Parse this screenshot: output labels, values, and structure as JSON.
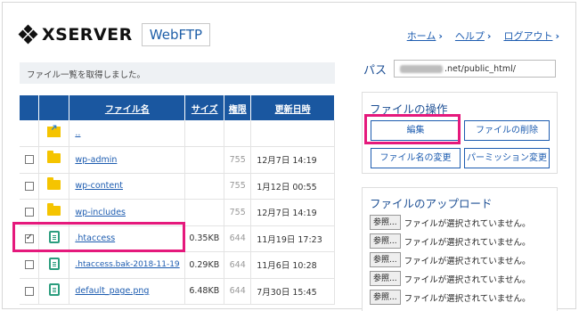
{
  "header": {
    "brand": "XSERVER",
    "app_badge": "WebFTP",
    "links": [
      {
        "label": "ホーム",
        "chevron": "›"
      },
      {
        "label": "ヘルプ",
        "chevron": "›"
      },
      {
        "label": "ログアウト",
        "chevron": "›"
      }
    ]
  },
  "status_message": "ファイル一覧を取得しました。",
  "path": {
    "label": "パス",
    "value_visible": ".net/public_html/"
  },
  "table": {
    "headers": [
      "ファイル名",
      "サイズ",
      "権限",
      "更新日時"
    ],
    "parent_link": "..",
    "rows": [
      {
        "name": "wp-admin",
        "type": "folder",
        "size": "",
        "perm": "755",
        "date": "12月7日 14:19",
        "checked": false
      },
      {
        "name": "wp-content",
        "type": "folder",
        "size": "",
        "perm": "755",
        "date": "1月12日 00:55",
        "checked": false
      },
      {
        "name": "wp-includes",
        "type": "folder",
        "size": "",
        "perm": "755",
        "date": "12月7日 14:19",
        "checked": false
      },
      {
        "name": ".htaccess",
        "type": "file",
        "size": "0.35KB",
        "perm": "644",
        "date": "11月19日 17:23",
        "checked": true
      },
      {
        "name": ".htaccess.bak-2018-11-19",
        "type": "file",
        "size": "0.29KB",
        "perm": "644",
        "date": "11月6日 10:28",
        "checked": false
      },
      {
        "name": "default_page.png",
        "type": "file",
        "size": "6.48KB",
        "perm": "644",
        "date": "7月30日 15:45",
        "checked": false
      }
    ]
  },
  "operations": {
    "title": "ファイルの操作",
    "edit": "編集",
    "delete": "ファイルの削除",
    "rename": "ファイル名の変更",
    "permission": "パーミッション変更"
  },
  "upload": {
    "title": "ファイルのアップロード",
    "browse": "参照...",
    "no_file": "ファイルが選択されていません。"
  },
  "colors": {
    "accent": "#1a57a0",
    "highlight": "#e5197c",
    "folder": "#f5c400",
    "file_icon": "#2b9d7e"
  }
}
